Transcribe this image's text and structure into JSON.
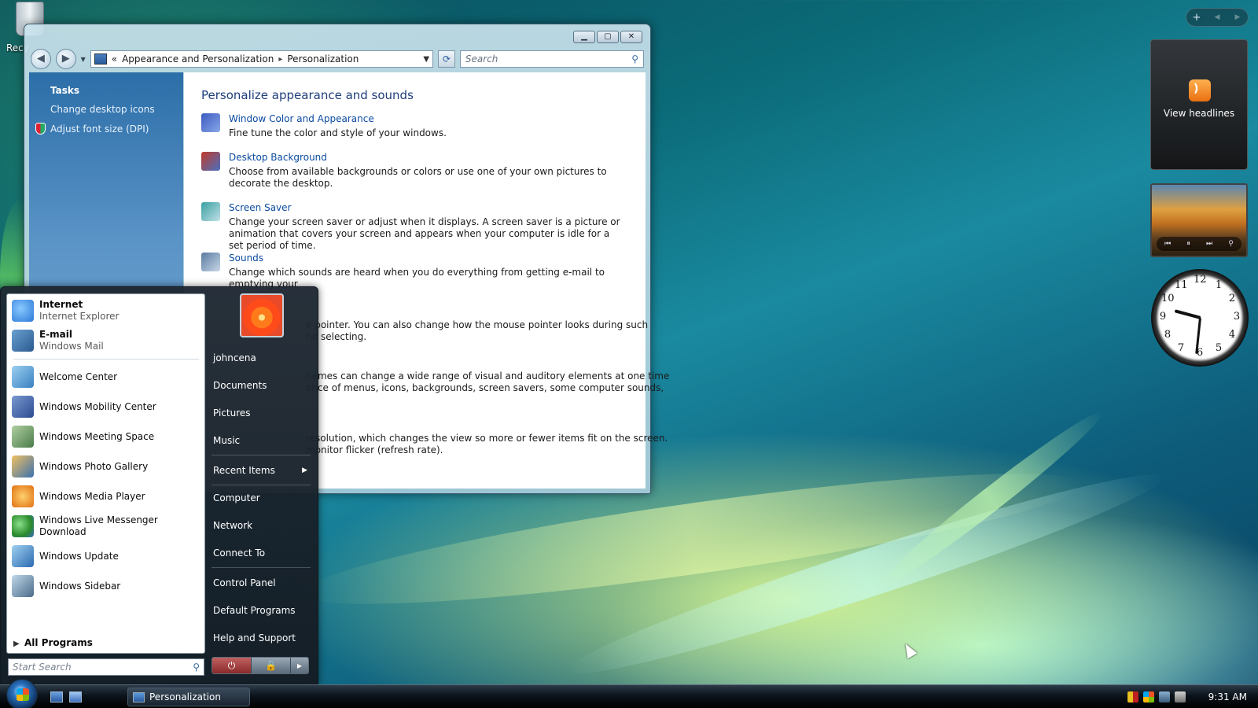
{
  "desktop": {
    "recycle_bin_label": "Recy"
  },
  "explorer": {
    "breadcrumb": {
      "prefix": "«",
      "crumb1": "Appearance and Personalization",
      "separator": "▸",
      "crumb2": "Personalization"
    },
    "search_placeholder": "Search",
    "tasks": {
      "title": "Tasks",
      "links": [
        "Change desktop icons",
        "Adjust font size (DPI)"
      ]
    },
    "heading": "Personalize appearance and sounds",
    "items": [
      {
        "link": "Window Color and Appearance",
        "desc": "Fine tune the color and style of your windows.",
        "icon_color": "#3a5ac0"
      },
      {
        "link": "Desktop Background",
        "desc": "Choose from available backgrounds or colors or use one of your own pictures to decorate the desktop.",
        "icon_color": "#c03a2a"
      },
      {
        "link": "Screen Saver",
        "desc": "Change your screen saver or adjust when it displays. A screen saver is a picture or animation that covers your screen and appears when your computer is idle for a set period of time.",
        "icon_color": "#3aa0a0"
      },
      {
        "link": "Sounds",
        "desc": "Change which sounds are heard when you do everything from getting e-mail to emptying your",
        "icon_color": "#5a7aa0"
      }
    ],
    "partial": {
      "line1": "e pointer. You can also change how the mouse pointer looks during such",
      "line2": "nd selecting.",
      "line3": "hemes can change a wide range of visual and auditory elements at one time",
      "line4": "ance of menus, icons, backgrounds, screen savers, some computer sounds,",
      "line5": "resolution, which changes the view so more or fewer items fit on the screen.",
      "line6": "monitor flicker (refresh rate)."
    }
  },
  "start_menu": {
    "pinned": [
      {
        "title": "Internet",
        "sub": "Internet Explorer",
        "color": "#2a7ad8"
      },
      {
        "title": "E-mail",
        "sub": "Windows Mail",
        "color": "#3a8ac0"
      }
    ],
    "recent": [
      {
        "label": "Welcome Center",
        "color": "#5a9ad0"
      },
      {
        "label": "Windows Mobility Center",
        "color": "#4a70b0"
      },
      {
        "label": "Windows Meeting Space",
        "color": "#6a9a6a"
      },
      {
        "label": "Windows Photo Gallery",
        "color": "#5a8ac8"
      },
      {
        "label": "Windows Media Player",
        "color": "#e08a20"
      },
      {
        "label": "Windows Live Messenger Download",
        "color": "#40a040"
      },
      {
        "label": "Windows Update",
        "color": "#3a80c8"
      },
      {
        "label": "Windows Sidebar",
        "color": "#7a9ab8"
      }
    ],
    "all_programs": "All Programs",
    "search_placeholder": "Start Search",
    "right": {
      "username": "johncena",
      "items": [
        "Documents",
        "Pictures",
        "Music"
      ],
      "recent_items": "Recent Items",
      "items2": [
        "Computer",
        "Network",
        "Connect To"
      ],
      "items3": [
        "Control Panel",
        "Default Programs",
        "Help and Support"
      ]
    }
  },
  "taskbar": {
    "window_button": "Personalization",
    "clock": "9:31 AM"
  },
  "sidebar": {
    "feed_label": "View headlines",
    "clock_numbers": [
      "12",
      "1",
      "2",
      "3",
      "4",
      "5",
      "6",
      "7",
      "8",
      "9",
      "10",
      "11"
    ]
  }
}
